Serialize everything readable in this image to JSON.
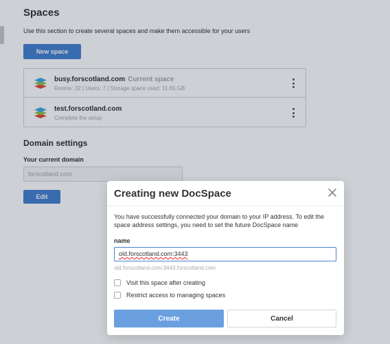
{
  "page": {
    "title": "Spaces",
    "description": "Use this section to create several spaces and make them accessible for your users",
    "new_space_label": "New space"
  },
  "spaces": [
    {
      "name": "busy.forscotland.com",
      "tag": "Current space",
      "subtitle": "Rooms: 32 | Users: 7 | Storage space used: 11.65 GB"
    },
    {
      "name": "test.forscotland.com",
      "tag": "",
      "subtitle": "Complete the setup"
    }
  ],
  "domain_settings": {
    "title": "Domain settings",
    "label": "Your current domain",
    "value": "forscotland.com",
    "edit_label": "Edit"
  },
  "dialog": {
    "title": "Creating new DocSpace",
    "text": "You have successfully connected your domain to your IP address. To edit the space address settings, you need to set the future DocSpace name",
    "name_label": "name",
    "name_value": "old.forscotland.com:3443",
    "hint": "old.forscotland.com:3443.forscotland.com",
    "checkbox_visit": "Visit this space after creating",
    "checkbox_restrict": "Restrict access to managing spaces",
    "create_label": "Create",
    "cancel_label": "Cancel"
  },
  "colors": {
    "accent": "#4781d1",
    "accent_light": "#6ba0e0",
    "muted_text": "#a3a9ae"
  }
}
